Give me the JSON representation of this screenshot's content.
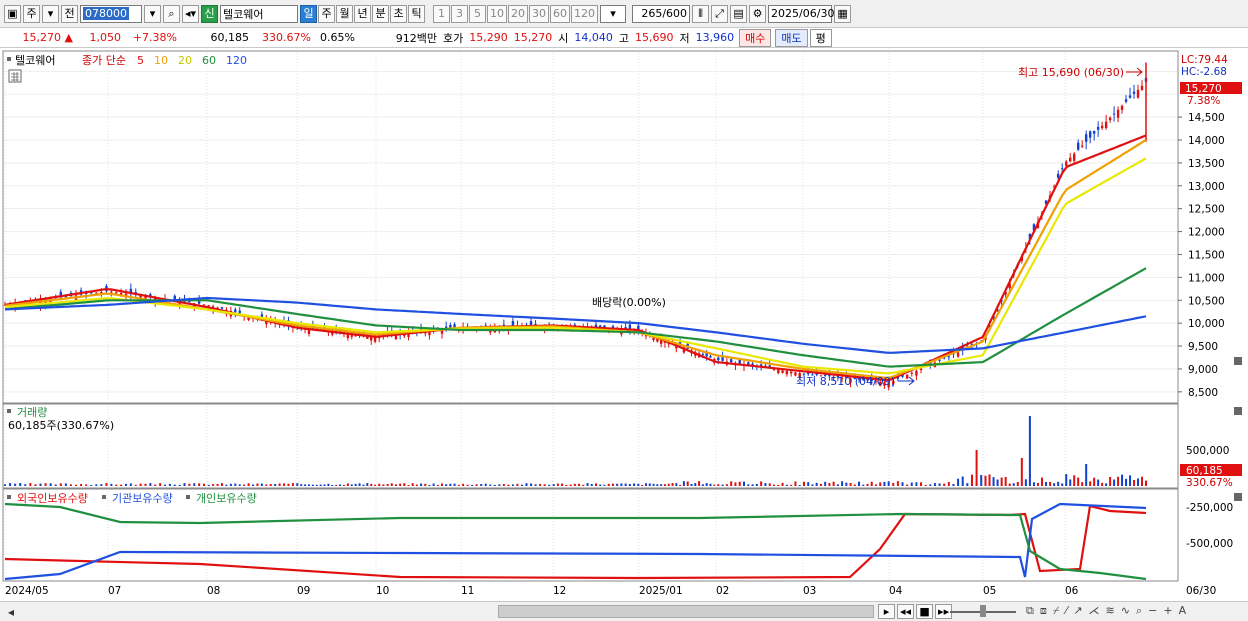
{
  "toolbar": {
    "period_select": "주",
    "prev_label": "전",
    "stock_code": "078000",
    "new_badge": "신",
    "stock_name": "텔코웨어",
    "periods": [
      "일",
      "주",
      "월",
      "년",
      "분",
      "초",
      "틱"
    ],
    "active_period": "일",
    "intervals": [
      "1",
      "3",
      "5",
      "10",
      "20",
      "30",
      "60",
      "120"
    ],
    "count": "265",
    "count_total": "/600",
    "date": "2025/06/30"
  },
  "quote": {
    "price": "15,270",
    "arrow": "▲",
    "change": "1,050",
    "change_pct": "+7.38%",
    "volume": "60,185",
    "vol_ratio": "330.67%",
    "turnover": "0.65%",
    "amount": "912백만",
    "ask_label": "호가",
    "ask": "15,290",
    "bid": "15,270",
    "open_label": "시",
    "open": "14,040",
    "high_label": "고",
    "high": "15,690",
    "low_label": "저",
    "low": "13,960",
    "buy_label": "매수",
    "sell_label": "매도",
    "eval_label": "평"
  },
  "price_panel": {
    "legend_name": "텔코웨어",
    "legend_type": "종가 단순",
    "ma_periods": [
      "5",
      "10",
      "20",
      "60",
      "120"
    ],
    "ma_colors": [
      "#e01010",
      "#f0a000",
      "#e8e800",
      "#209040",
      "#2050e0"
    ],
    "lc": "LC:79.44",
    "hc": "HC:-2.68",
    "current_price": "15,270",
    "current_pct": "7.38%",
    "high_note": "최고 15,690 (06/30)",
    "low_note": "최저 8,510 (04/09)",
    "dividend_note": "배당락(0.00%)",
    "y_ticks": [
      "14,500",
      "14,000",
      "13,500",
      "13,000",
      "12,500",
      "12,000",
      "11,500",
      "11,000",
      "10,500",
      "10,000",
      "9,500",
      "9,000",
      "8,500"
    ]
  },
  "volume_panel": {
    "title": "거래량",
    "value_text": "60,185주(330.67%)",
    "y_tick": "500,000",
    "current": "60,185",
    "current_pct": "330.67%"
  },
  "holding_panel": {
    "series": [
      {
        "name": "외국인보유수량",
        "color": "#e01010"
      },
      {
        "name": "기관보유수량",
        "color": "#2050e0"
      },
      {
        "name": "개인보유수량",
        "color": "#209040"
      }
    ],
    "y_ticks": [
      "-250,000",
      "-500,000"
    ]
  },
  "x_axis": [
    "2024/05",
    "07",
    "08",
    "09",
    "10",
    "11",
    "12",
    "2025/01",
    "02",
    "03",
    "04",
    "05",
    "06",
    "06/30"
  ],
  "chart_data": {
    "type": "line",
    "title": "텔코웨어",
    "x": [
      "2024/05",
      "07",
      "08",
      "09",
      "10",
      "11",
      "12",
      "2025/01",
      "02",
      "03",
      "04",
      "05",
      "06",
      "06/30"
    ],
    "series": [
      {
        "name": "종가",
        "values": [
          10400,
          10700,
          10400,
          9900,
          9700,
          9900,
          9950,
          9850,
          9200,
          8900,
          8700,
          9600,
          13500,
          15270
        ]
      },
      {
        "name": "5",
        "values": [
          10400,
          10750,
          10350,
          9900,
          9700,
          9900,
          9950,
          9850,
          9150,
          8950,
          8750,
          9700,
          13400,
          14100
        ]
      },
      {
        "name": "10",
        "values": [
          10380,
          10650,
          10300,
          9950,
          9750,
          9900,
          9930,
          9800,
          9300,
          9000,
          8800,
          9600,
          12900,
          14000
        ]
      },
      {
        "name": "20",
        "values": [
          10350,
          10550,
          10300,
          10000,
          9800,
          9880,
          9900,
          9800,
          9450,
          9050,
          8900,
          9300,
          12600,
          13600
        ]
      },
      {
        "name": "60",
        "values": [
          10300,
          10500,
          10500,
          10200,
          9950,
          9850,
          9850,
          9800,
          9600,
          9300,
          9050,
          9150,
          10200,
          11200
        ]
      },
      {
        "name": "120",
        "values": [
          10300,
          10400,
          10550,
          10450,
          10300,
          10200,
          10100,
          10000,
          9800,
          9550,
          9350,
          9450,
          9800,
          10150
        ]
      }
    ],
    "ylim": [
      8300,
      15900
    ],
    "high": 15690,
    "low": 8510
  }
}
